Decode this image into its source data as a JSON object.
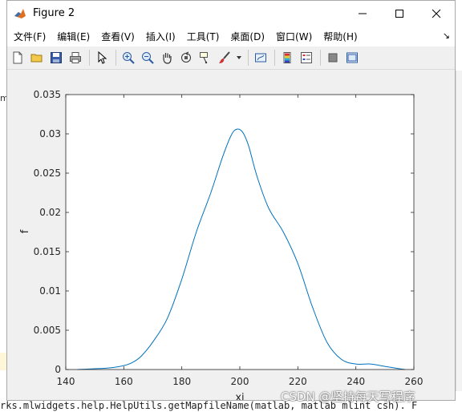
{
  "window": {
    "title": "Figure 2"
  },
  "menu": [
    {
      "label": "文件(F)"
    },
    {
      "label": "编辑(E)"
    },
    {
      "label": "查看(V)"
    },
    {
      "label": "插入(I)"
    },
    {
      "label": "工具(T)"
    },
    {
      "label": "桌面(D)"
    },
    {
      "label": "窗口(W)"
    },
    {
      "label": "帮助(H)"
    }
  ],
  "toolbar": {
    "icons": [
      "new-figure",
      "open",
      "save",
      "print",
      "pointer",
      "zoom-in",
      "zoom-out",
      "pan",
      "rotate-3d",
      "data-cursor",
      "brush",
      "link-plot",
      "insert-colorbar",
      "insert-legend",
      "hide-plot-tools",
      "show-plot-tools"
    ]
  },
  "background": {
    "left_fragment": "m",
    "code_line": "rks.mlwidgets.help.HelpUtils.getMapfileName(matlab, matlab mlint csh). F"
  },
  "watermark": "CSDN @坚持每天写程序",
  "chart_data": {
    "type": "line",
    "title": "",
    "xlabel": "xi",
    "ylabel": "f",
    "xlim": [
      140,
      260
    ],
    "ylim": [
      0,
      0.035
    ],
    "xticks": [
      "140",
      "160",
      "180",
      "200",
      "220",
      "240",
      "260"
    ],
    "yticks": [
      "0",
      "0.005",
      "0.01",
      "0.015",
      "0.02",
      "0.025",
      "0.03",
      "0.035"
    ],
    "grid": false,
    "color": "#0072BD",
    "series": [
      {
        "x": [
          144,
          150,
          155,
          160,
          163,
          166,
          170,
          175,
          180,
          185,
          190,
          194,
          197,
          199,
          201,
          203,
          206,
          210,
          215,
          220,
          225,
          230,
          235,
          240,
          245,
          250,
          255,
          257
        ],
        "y": [
          0.0,
          0.0001,
          0.0002,
          0.0005,
          0.0009,
          0.0017,
          0.0035,
          0.0065,
          0.0115,
          0.0175,
          0.0225,
          0.027,
          0.0298,
          0.0306,
          0.0302,
          0.0285,
          0.0245,
          0.0205,
          0.0175,
          0.0135,
          0.008,
          0.0035,
          0.0013,
          0.0007,
          0.0007,
          0.0004,
          0.0001,
          0.0
        ]
      }
    ]
  }
}
